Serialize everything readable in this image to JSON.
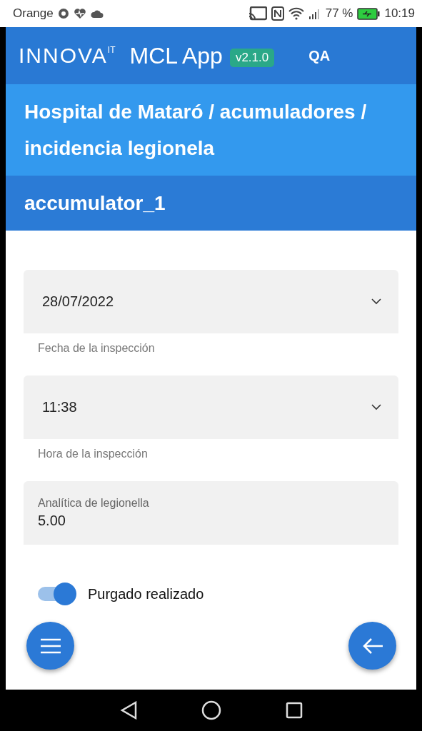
{
  "status_bar": {
    "carrier": "Orange",
    "battery_percent": "77 %",
    "time": "10:19"
  },
  "app_bar": {
    "logo": "INNOVA",
    "logo_suffix": "IT",
    "title": "MCL App",
    "version": "v2.1.0",
    "environment": "QA"
  },
  "breadcrumb": "Hospital de Mataró / acumuladores / incidencia legionela",
  "subtitle": "accumulator_1",
  "fields": [
    {
      "kind": "select",
      "value": "28/07/2022",
      "helper": "Fecha de la inspección"
    },
    {
      "kind": "select",
      "value": "11:38",
      "helper": "Hora de la inspección"
    },
    {
      "kind": "text",
      "label": "Analítica de legionella",
      "value": "5.00"
    }
  ],
  "toggle": {
    "label": "Purgado realizado",
    "on": true
  }
}
